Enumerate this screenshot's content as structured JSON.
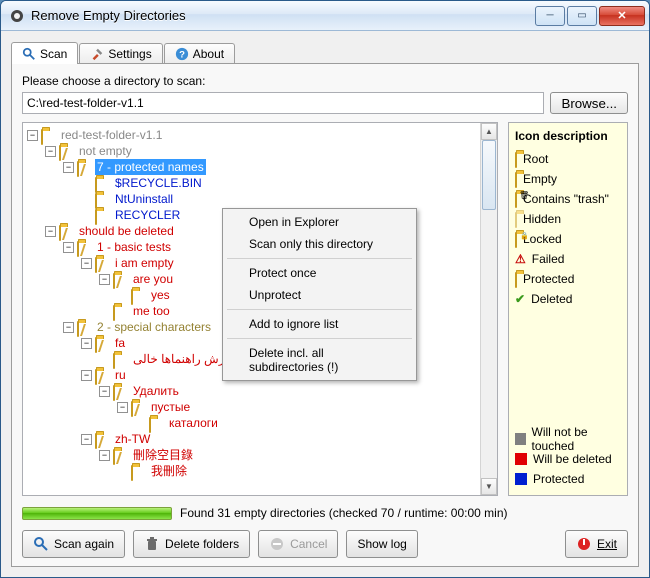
{
  "window": {
    "title": "Remove Empty Directories"
  },
  "tabs": {
    "scan": "Scan",
    "settings": "Settings",
    "about": "About"
  },
  "dirprompt": "Please choose a directory to scan:",
  "path": "C:\\red-test-folder-v1.1",
  "browse": "Browse...",
  "tree": {
    "root": "red-test-folder-v1.1",
    "not_empty": "not empty",
    "protected": "7 - protected names",
    "recycle": "$RECYCLE.BIN",
    "ntuninstall": "NtUninstall",
    "recycler": "RECYCLER",
    "should_delete": "should be deleted",
    "basic": "1 - basic tests",
    "iam": "i am empty",
    "areyou": "are you",
    "yes": "yes",
    "metoo": "me too",
    "special": "2 - special characters",
    "fa": "fa",
    "fa_text": "گزارش راهنماها خالی",
    "ru": "ru",
    "ru1": "Удалить",
    "ru2": "пустые",
    "ru3": "каталоги",
    "zh": "zh-TW",
    "zh1": "刪除空目錄",
    "zh2": "我刪除"
  },
  "context": {
    "open": "Open in Explorer",
    "scanonly": "Scan only this directory",
    "protect": "Protect once",
    "unprotect": "Unprotect",
    "ignore": "Add to ignore list",
    "delete": "Delete incl. all subdirectories (!)"
  },
  "legend": {
    "title": "Icon description",
    "root": "Root",
    "empty": "Empty",
    "trash": "Contains \"trash\"",
    "hidden": "Hidden",
    "locked": "Locked",
    "failed": "Failed",
    "protected": "Protected",
    "deleted": "Deleted",
    "willnot": "Will not be touched",
    "willdel": "Will be deleted",
    "prot": "Protected"
  },
  "status": "Found 31 empty directories (checked 70 / runtime: 00:00 min)",
  "buttons": {
    "scan": "Scan again",
    "delete": "Delete folders",
    "cancel": "Cancel",
    "showlog": "Show log",
    "exit": "Exit"
  }
}
